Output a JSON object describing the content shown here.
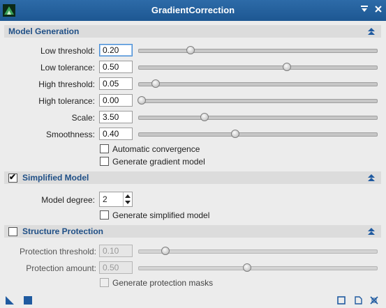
{
  "window": {
    "title": "GradientCorrection"
  },
  "colors": {
    "titlebar": "#2468a6",
    "section_title": "#1f4f86",
    "focus": "#4a8fd6"
  },
  "model_generation": {
    "title": "Model Generation",
    "params": [
      {
        "label": "Low threshold:",
        "value": "0.20",
        "position": 0.21
      },
      {
        "label": "Low tolerance:",
        "value": "0.50",
        "position": 0.62
      },
      {
        "label": "High threshold:",
        "value": "0.05",
        "position": 0.06
      },
      {
        "label": "High tolerance:",
        "value": "0.00",
        "position": 0.0
      },
      {
        "label": "Scale:",
        "value": "3.50",
        "position": 0.27
      },
      {
        "label": "Smoothness:",
        "value": "0.40",
        "position": 0.4
      }
    ],
    "checkboxes": [
      {
        "label": "Automatic convergence",
        "checked": false
      },
      {
        "label": "Generate gradient model",
        "checked": false
      }
    ]
  },
  "simplified_model": {
    "title": "Simplified Model",
    "enabled": true,
    "degree_label": "Model degree:",
    "degree_value": "2",
    "checkbox": {
      "label": "Generate simplified model",
      "checked": false
    }
  },
  "structure_protection": {
    "title": "Structure Protection",
    "enabled": false,
    "params": [
      {
        "label": "Protection threshold:",
        "value": "0.10",
        "position": 0.1
      },
      {
        "label": "Protection amount:",
        "value": "0.50",
        "position": 0.45
      }
    ],
    "checkbox": {
      "label": "Generate protection masks",
      "checked": false
    }
  }
}
